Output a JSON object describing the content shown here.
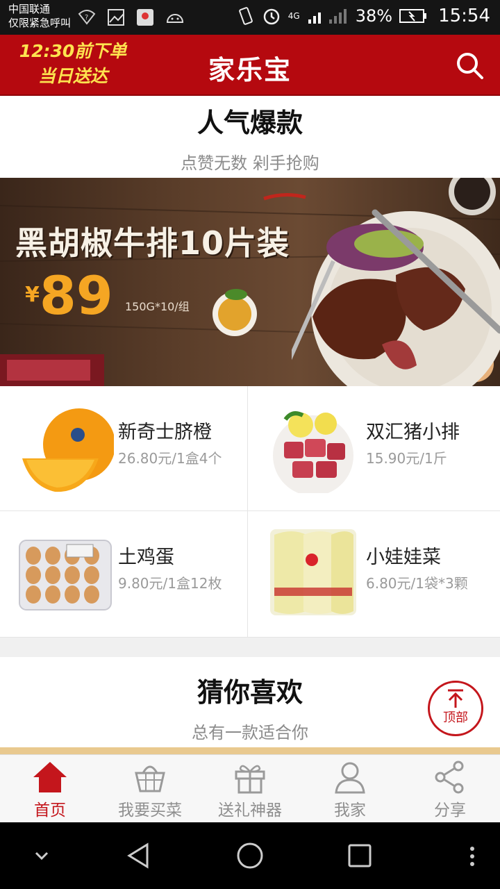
{
  "status_bar": {
    "carrier_line1": "中国联通",
    "carrier_line2": "仅限紧急呼叫",
    "network": "4G",
    "battery": "38%",
    "time": "15:54"
  },
  "header": {
    "promo_line1": "12:30前下单",
    "promo_line2": "当日送达",
    "title": "家乐宝",
    "search_icon": "search-icon"
  },
  "popular": {
    "title": "人气爆款",
    "subtitle": "点赞无数 剁手抢购"
  },
  "banner": {
    "title": "黑胡椒牛排10片装",
    "currency": "¥",
    "price": "89",
    "spec": "150G*10/组"
  },
  "products": [
    {
      "name": "新奇士脐橙",
      "price": "26.80元/1盒4个"
    },
    {
      "name": "双汇猪小排",
      "price": "15.90元/1斤"
    },
    {
      "name": "土鸡蛋",
      "price": "9.80元/1盒12枚"
    },
    {
      "name": "小娃娃菜",
      "price": "6.80元/1袋*3颗"
    }
  ],
  "guess": {
    "title": "猜你喜欢",
    "subtitle": "总有一款适合你"
  },
  "back_to_top": {
    "label": "顶部"
  },
  "tabs": [
    {
      "label": "首页",
      "icon": "home-icon",
      "active": true
    },
    {
      "label": "我要买菜",
      "icon": "basket-icon",
      "active": false
    },
    {
      "label": "送礼神器",
      "icon": "gift-icon",
      "active": false
    },
    {
      "label": "我家",
      "icon": "user-icon",
      "active": false
    },
    {
      "label": "分享",
      "icon": "share-icon",
      "active": false
    }
  ],
  "colors": {
    "brand_red": "#b5090f",
    "promo_yellow": "#fde34f",
    "price_orange": "#f5a623"
  }
}
